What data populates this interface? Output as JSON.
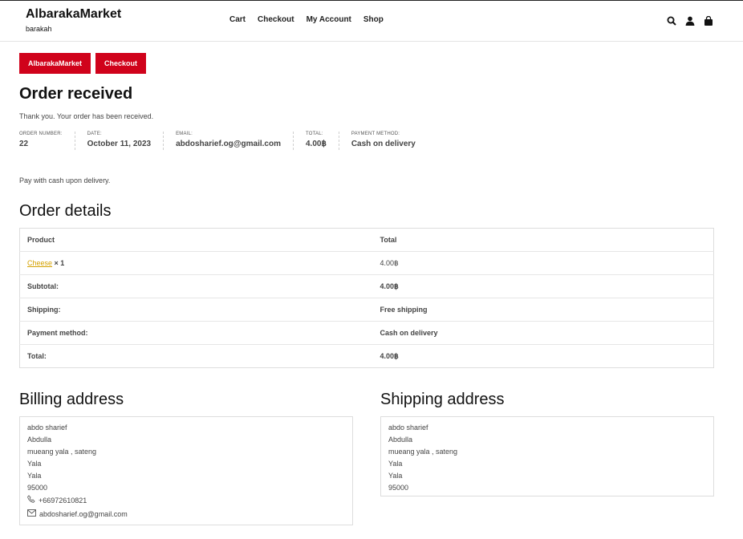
{
  "header": {
    "site_title": "AlbarakaMarket",
    "tagline": "barakah",
    "nav": [
      "Cart",
      "Checkout",
      "My Account",
      "Shop"
    ],
    "icons": [
      "search-icon",
      "account-icon",
      "bag-icon"
    ]
  },
  "breadcrumbs": [
    "AlbarakaMarket",
    "Checkout"
  ],
  "page_title": "Order received",
  "thanks": "Thank you. Your order has been received.",
  "overview": [
    {
      "label": "ORDER NUMBER:",
      "value": "22"
    },
    {
      "label": "DATE:",
      "value": "October 11, 2023"
    },
    {
      "label": "EMAIL:",
      "value": "abdosharief.og@gmail.com"
    },
    {
      "label": "TOTAL:",
      "value": "4.00฿"
    },
    {
      "label": "PAYMENT METHOD:",
      "value": "Cash on delivery"
    }
  ],
  "pay_note": "Pay with cash upon delivery.",
  "order_details": {
    "heading": "Order details",
    "col_product": "Product",
    "col_total": "Total",
    "item": {
      "name": "Cheese",
      "qty": "× 1",
      "total": "4.00฿"
    },
    "rows": [
      {
        "label": "Subtotal:",
        "value": "4.00฿"
      },
      {
        "label": "Shipping:",
        "value": "Free shipping"
      },
      {
        "label": "Payment method:",
        "value": "Cash on delivery"
      },
      {
        "label": "Total:",
        "value": "4.00฿"
      }
    ]
  },
  "billing": {
    "heading": "Billing address",
    "lines": [
      "abdo sharief",
      "Abdulla",
      "mueang yala , sateng",
      "Yala",
      "Yala",
      "95000"
    ],
    "phone": "+66972610821",
    "email": "abdosharief.og@gmail.com"
  },
  "shipping": {
    "heading": "Shipping address",
    "lines": [
      "abdo sharief",
      "Abdulla",
      "mueang yala , sateng",
      "Yala",
      "Yala",
      "95000"
    ]
  }
}
